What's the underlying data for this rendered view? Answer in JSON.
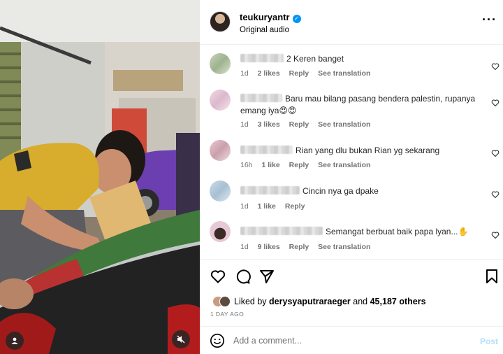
{
  "post": {
    "username": "teukuryantr",
    "verified_icon": "verified-badge-icon",
    "audio_label": "Original audio",
    "more_icon": "more-options-icon"
  },
  "comments": [
    {
      "text": "2 Keren banget",
      "time": "1d",
      "likes": "2 likes",
      "reply": "Reply",
      "translate": "See translation"
    },
    {
      "text": "Baru mau bilang pasang bendera palestin, rupanya emang iya😍😍",
      "time": "1d",
      "likes": "3 likes",
      "reply": "Reply",
      "translate": "See translation"
    },
    {
      "text": "Rian yang dlu bukan Rian yg sekarang",
      "time": "16h",
      "likes": "1 like",
      "reply": "Reply",
      "translate": "See translation"
    },
    {
      "text": "Cincin nya ga dpake",
      "time": "1d",
      "likes": "1 like",
      "reply": "Reply",
      "translate": ""
    },
    {
      "text": "Semangat berbuat baik papa lyan...✋",
      "time": "1d",
      "likes": "9 likes",
      "reply": "Reply",
      "translate": "See translation"
    }
  ],
  "actions": {
    "liked_prefix": "Liked by",
    "liked_user": "derysyaputraraeger",
    "liked_and": "and",
    "liked_others": "45,187 others",
    "date": "1 DAY AGO",
    "icons": [
      "heart-icon",
      "comment-icon",
      "share-icon",
      "save-icon"
    ]
  },
  "add_comment": {
    "placeholder": "Add a comment...",
    "post_label": "Post"
  },
  "colors": {
    "accent": "#0095f6",
    "post_disabled": "#b2dffc",
    "meta_gray": "#737373"
  }
}
